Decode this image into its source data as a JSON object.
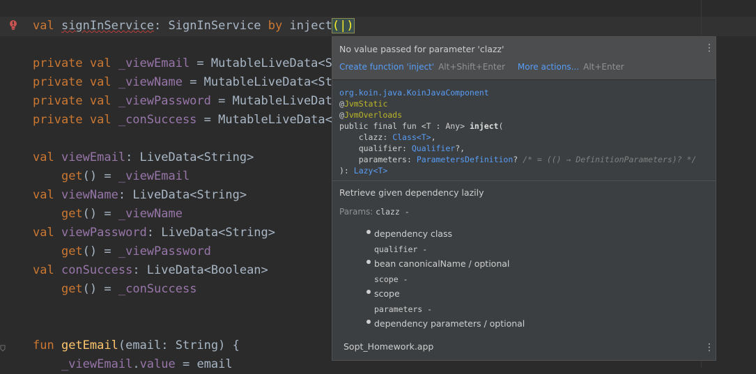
{
  "editor": {
    "lines": [
      {
        "parts": [
          [
            "kw",
            "val "
          ],
          [
            "errprop",
            "signInService"
          ],
          [
            "t",
            ": SignInService "
          ],
          [
            "kw",
            "by "
          ],
          [
            "t",
            "inject"
          ],
          [
            "caret",
            "(|)"
          ]
        ]
      },
      {
        "parts": []
      },
      {
        "parts": [
          [
            "kw",
            "private val "
          ],
          [
            "prop",
            "_viewEmail"
          ],
          [
            "t",
            " = MutableLiveData<St"
          ]
        ]
      },
      {
        "parts": [
          [
            "kw",
            "private val "
          ],
          [
            "prop",
            "_viewName"
          ],
          [
            "t",
            " = MutableLiveData<Str"
          ]
        ]
      },
      {
        "parts": [
          [
            "kw",
            "private val "
          ],
          [
            "prop",
            "_viewPassword"
          ],
          [
            "t",
            " = MutableLiveData"
          ]
        ]
      },
      {
        "parts": [
          [
            "kw",
            "private val "
          ],
          [
            "prop",
            "_conSuccess"
          ],
          [
            "t",
            " = MutableLiveData<B"
          ]
        ]
      },
      {
        "parts": []
      },
      {
        "parts": [
          [
            "kw",
            "val "
          ],
          [
            "prop",
            "viewEmail"
          ],
          [
            "t",
            ": LiveData<String>"
          ]
        ]
      },
      {
        "parts": [
          [
            "t",
            "    "
          ],
          [
            "kw",
            "get"
          ],
          [
            "t",
            "() = "
          ],
          [
            "prop",
            "_viewEmail"
          ]
        ]
      },
      {
        "parts": [
          [
            "kw",
            "val "
          ],
          [
            "prop",
            "viewName"
          ],
          [
            "t",
            ": LiveData<String>"
          ]
        ]
      },
      {
        "parts": [
          [
            "t",
            "    "
          ],
          [
            "kw",
            "get"
          ],
          [
            "t",
            "() = "
          ],
          [
            "prop",
            "_viewName"
          ]
        ]
      },
      {
        "parts": [
          [
            "kw",
            "val "
          ],
          [
            "prop",
            "viewPassword"
          ],
          [
            "t",
            ": LiveData<String>"
          ]
        ]
      },
      {
        "parts": [
          [
            "t",
            "    "
          ],
          [
            "kw",
            "get"
          ],
          [
            "t",
            "() = "
          ],
          [
            "prop",
            "_viewPassword"
          ]
        ]
      },
      {
        "parts": [
          [
            "kw",
            "val "
          ],
          [
            "prop",
            "conSuccess"
          ],
          [
            "t",
            ": LiveData<Boolean>"
          ]
        ]
      },
      {
        "parts": [
          [
            "t",
            "    "
          ],
          [
            "kw",
            "get"
          ],
          [
            "t",
            "() = "
          ],
          [
            "prop",
            "_conSuccess"
          ]
        ]
      },
      {
        "parts": []
      },
      {
        "parts": []
      },
      {
        "parts": [
          [
            "kw",
            "fun "
          ],
          [
            "fn",
            "getEmail"
          ],
          [
            "t",
            "(email: String) {"
          ]
        ]
      },
      {
        "parts": [
          [
            "t",
            "    "
          ],
          [
            "prop",
            "_viewEmail"
          ],
          [
            "t",
            "."
          ],
          [
            "prop",
            "value"
          ],
          [
            "t",
            " = email"
          ]
        ]
      }
    ]
  },
  "popup": {
    "message": "No value passed for parameter 'clazz'",
    "action1_label": "Create function 'inject'",
    "action1_shortcut": "Alt+Shift+Enter",
    "action2_label": "More actions...",
    "action2_shortcut": "Alt+Enter",
    "signature": {
      "package": "org.koin.java.KoinJavaComponent",
      "annotations": [
        "JvmStatic",
        "JvmOverloads"
      ],
      "decl": "public final fun <T : Any> ",
      "name": "inject",
      "params": [
        {
          "name": "clazz",
          "type": "Class<T>",
          "suffix": ","
        },
        {
          "name": "qualifier",
          "type": "Qualifier",
          "suffix": "?,"
        },
        {
          "name": "parameters",
          "type": "ParametersDefinition",
          "suffix": "? ",
          "comment": "/* = (() → DefinitionParameters)? */"
        }
      ],
      "return_type": "Lazy<T>"
    },
    "description": "Retrieve given dependency lazily",
    "params_label": "Params:",
    "params_first": "clazz -",
    "param_list": [
      {
        "kind": "bullet",
        "text": "dependency class"
      },
      {
        "kind": "name",
        "text": "qualifier -"
      },
      {
        "kind": "bullet",
        "text": "bean canonicalName / optional"
      },
      {
        "kind": "name",
        "text": "scope -"
      },
      {
        "kind": "bullet",
        "text": "scope"
      },
      {
        "kind": "name",
        "text": "parameters -"
      },
      {
        "kind": "bullet",
        "text": "dependency parameters / optional"
      }
    ],
    "module": "Sopt_Homework.app"
  },
  "icons": {
    "error_bulb": "red-error-bulb-icon",
    "menu": "kebab-menu-icon"
  },
  "colors": {
    "keyword": "#cc7832",
    "property": "#9876aa",
    "function": "#ffc66d",
    "link": "#589df6",
    "background": "#2b2b2b",
    "popup": "#3c3f41"
  }
}
